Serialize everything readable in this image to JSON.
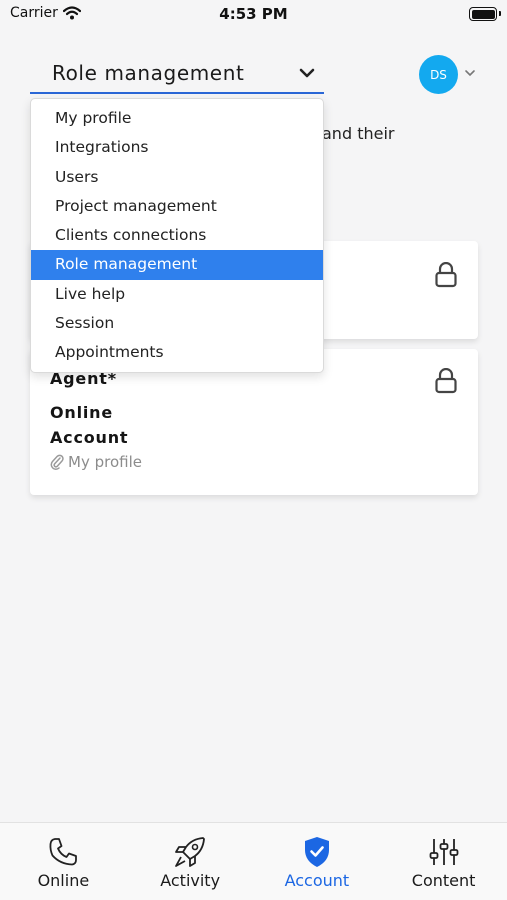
{
  "status_bar": {
    "carrier": "Carrier",
    "time": "4:53 PM"
  },
  "header": {
    "selected_section": "Role management",
    "avatar_initials": "DS"
  },
  "background_text": "and their",
  "dropdown": {
    "items": [
      {
        "label": "My profile"
      },
      {
        "label": "Integrations"
      },
      {
        "label": "Users"
      },
      {
        "label": "Project management"
      },
      {
        "label": "Clients connections"
      },
      {
        "label": "Role management",
        "selected": true
      },
      {
        "label": "Live help"
      },
      {
        "label": "Session"
      },
      {
        "label": "Appointments"
      }
    ]
  },
  "cards": [
    {
      "title": "Agent*",
      "lines": [
        "Online",
        "Account"
      ],
      "link": "My profile",
      "locked": true
    }
  ],
  "tabbar": {
    "tabs": [
      {
        "label": "Online",
        "icon": "phone-icon"
      },
      {
        "label": "Activity",
        "icon": "rocket-icon"
      },
      {
        "label": "Account",
        "icon": "shield-check-icon",
        "active": true
      },
      {
        "label": "Content",
        "icon": "sliders-icon"
      }
    ]
  },
  "colors": {
    "accent": "#2f80ed",
    "active_tab": "#1c67e3",
    "avatar": "#13a9ef",
    "background": "#f5f5f6"
  }
}
